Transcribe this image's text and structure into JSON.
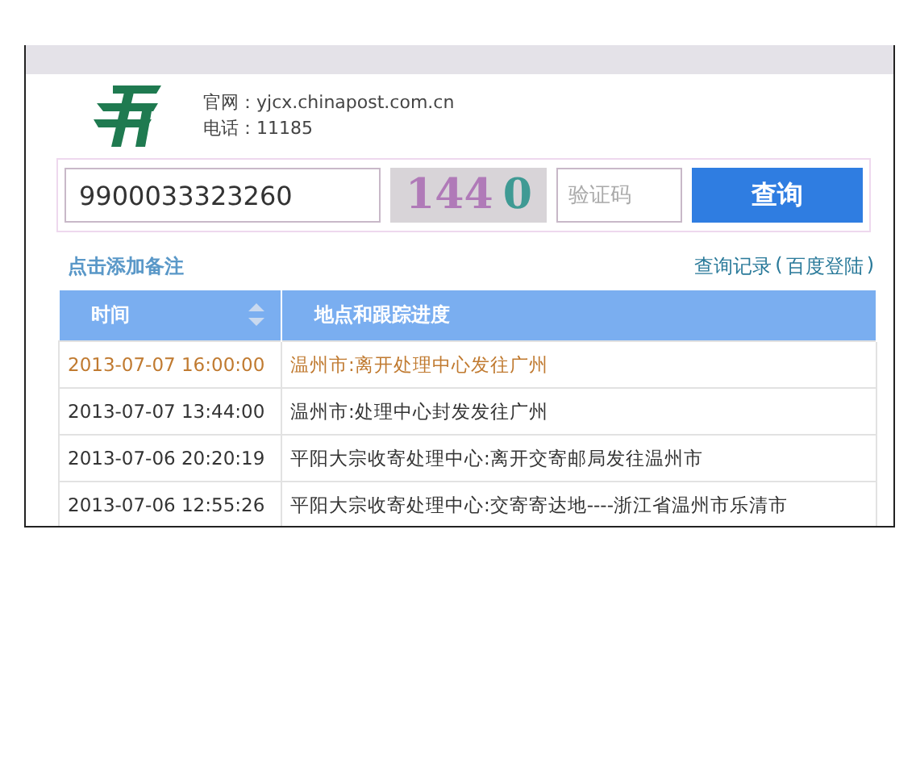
{
  "site": {
    "website_label": "官网：",
    "website": "yjcx.chinapost.com.cn",
    "phone_label": "电话：",
    "phone": "11185"
  },
  "search": {
    "tracking_number": "9900033323260",
    "captcha_text": "1440",
    "captcha_placeholder": "验证码",
    "button": "查询"
  },
  "links": {
    "add_note": "点击添加备注",
    "history": "查询记录",
    "login_open": "(",
    "login": "百度登陆",
    "login_close": ")"
  },
  "table": {
    "columns": [
      {
        "label": "时间",
        "sortable": true
      },
      {
        "label": "地点和跟踪进度",
        "sortable": false
      }
    ],
    "rows": [
      {
        "time": "2013-07-07 16:00:00",
        "event": "温州市:离开处理中心发往广州",
        "highlighted": true
      },
      {
        "time": "2013-07-07 13:44:00",
        "event": "温州市:处理中心封发发往广州",
        "highlighted": false
      },
      {
        "time": "2013-07-06 20:20:19",
        "event": "平阳大宗收寄处理中心:离开交寄邮局发往温州市",
        "highlighted": false
      },
      {
        "time": "2013-07-06 12:55:26",
        "event": "平阳大宗收寄处理中心:交寄寄达地----浙江省温州市乐清市",
        "highlighted": false
      }
    ]
  }
}
